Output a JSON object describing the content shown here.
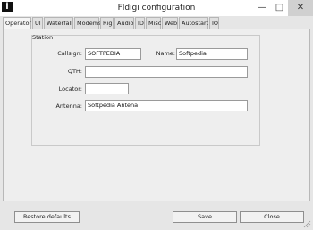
{
  "window": {
    "title": "Fldigi configuration",
    "app_icon": "i",
    "minimize_icon": "—",
    "maximize_icon": "□",
    "close_icon": "✕"
  },
  "tabs": [
    "Operator",
    "UI",
    "Waterfall",
    "Modems",
    "Rig",
    "Audio",
    "ID",
    "Misc",
    "Web",
    "Autostart",
    "IO"
  ],
  "station": {
    "group_label": "Station",
    "callsign_label": "Callsign:",
    "callsign_value": "SOFTPEDIA",
    "name_label": "Name:",
    "name_value": "Softpedia",
    "qth_label": "QTH:",
    "qth_value": "",
    "locator_label": "Locator:",
    "locator_value": "",
    "antenna_label": "Antenna:",
    "antenna_value": "Softpedia Antena"
  },
  "buttons": {
    "restore_defaults": "Restore defaults",
    "save": "Save",
    "close": "Close"
  }
}
